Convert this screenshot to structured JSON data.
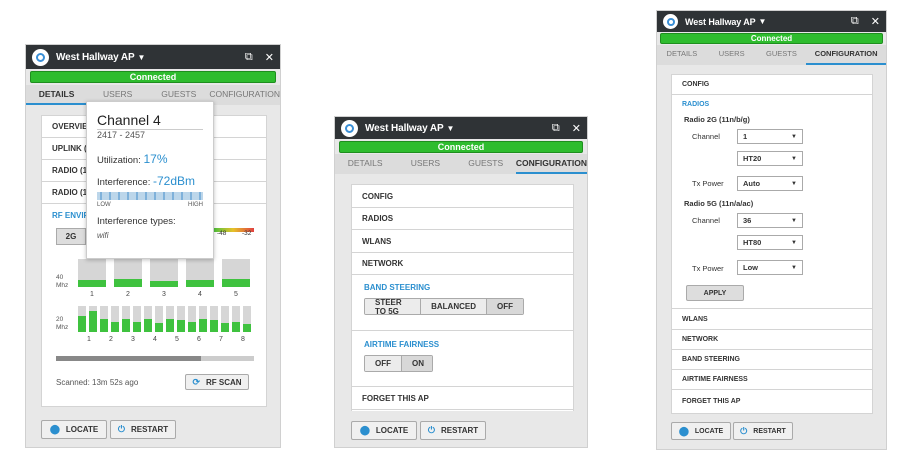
{
  "ap_name": "West Hallway AP",
  "connected": "Connected",
  "tabs": [
    "DETAILS",
    "USERS",
    "GUESTS",
    "CONFIGURATION"
  ],
  "left": {
    "rows": [
      "OVERVIEW",
      "UPLINK (",
      "RADIO (1",
      "RADIO (1"
    ],
    "rf_title": "RF ENVIRO",
    "band_btn": "2G",
    "signal_labels": [
      "-48",
      "-32"
    ],
    "axis_40": "40",
    "axis_20": "20",
    "axis_unit": "Mhz",
    "ch40_labels": [
      "1",
      "2",
      "3",
      "4",
      "5"
    ],
    "ch40_util": [
      0.25,
      0.3,
      0.2,
      0.25,
      0.3
    ],
    "ch20_labels": [
      "1",
      "2",
      "3",
      "4",
      "5",
      "6",
      "7",
      "8"
    ],
    "ch20_util": [
      0.6,
      0.8,
      0.5,
      0.4,
      0.5,
      0.4,
      0.5,
      0.35,
      0.5,
      0.45,
      0.4,
      0.5,
      0.45,
      0.35,
      0.4,
      0.3
    ],
    "scan_progress": 0.73,
    "scanned": "Scanned: 13m 52s ago",
    "rf_scan": "RF SCAN",
    "tooltip": {
      "channel": "Channel 4",
      "range": "2417 - 2457",
      "util_label": "Utilization:",
      "util_value": "17%",
      "interf_label": "Interference:",
      "interf_value": "-72dBm",
      "low": "LOW",
      "high": "HIGH",
      "types_label": "Interference types:",
      "types_value": "wifi"
    }
  },
  "mid": {
    "rows": [
      "CONFIG",
      "RADIOS",
      "WLANS",
      "NETWORK"
    ],
    "band_steering": "BAND STEERING",
    "bs_options": [
      "STEER TO 5G",
      "BALANCED",
      "OFF"
    ],
    "airtime": "AIRTIME FAIRNESS",
    "af_options": [
      "OFF",
      "ON"
    ],
    "forget": "FORGET THIS AP"
  },
  "right": {
    "config": "CONFIG",
    "radios": "RADIOS",
    "radio2g": "Radio 2G (11n/b/g)",
    "radio5g": "Radio 5G (11n/a/ac)",
    "channel_label": "Channel",
    "tx_label": "Tx Power",
    "ch2g": "1",
    "ht2g": "HT20",
    "tx2g": "Auto",
    "ch5g": "36",
    "ht5g": "HT80",
    "tx5g": "Low",
    "apply": "APPLY",
    "rows": [
      "WLANS",
      "NETWORK",
      "BAND STEERING",
      "AIRTIME FAIRNESS",
      "FORGET THIS AP"
    ]
  },
  "locate": "LOCATE",
  "restart": "RESTART"
}
